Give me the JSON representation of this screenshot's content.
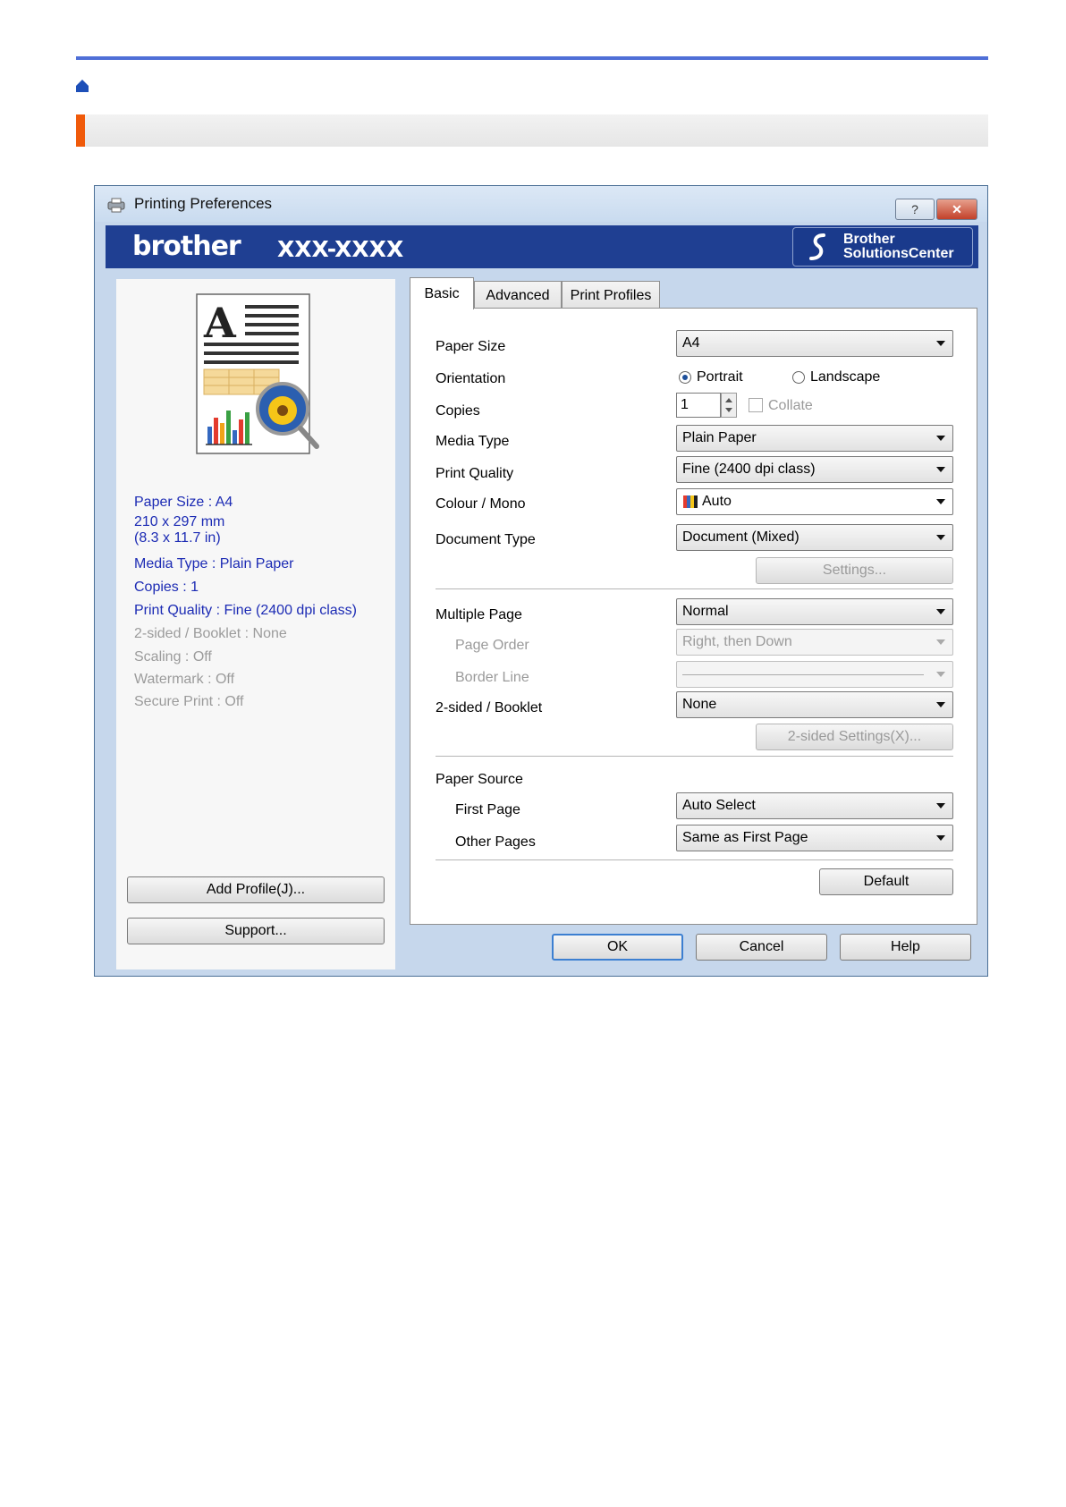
{
  "colors": {
    "header_line": "#4f6fd7",
    "section_accent": "#f05a0a",
    "brand_bar": "#1f3f92",
    "summary_text": "#1c2bb4"
  },
  "page": {
    "home_icon": "home-icon"
  },
  "dialog": {
    "title": "Printing Preferences",
    "help_button": "?",
    "close_button": "✕",
    "brand": {
      "logo": "brother",
      "model": "XXX-XXXX",
      "solutions_line1": "Brother",
      "solutions_line2": "SolutionsCenter"
    },
    "summary": {
      "paper_size": "Paper Size : A4",
      "dimensions_mm": "210 x 297 mm",
      "dimensions_in": "(8.3 x 11.7 in)",
      "media_type": "Media Type : Plain Paper",
      "copies": "Copies : 1",
      "print_quality": "Print Quality : Fine (2400 dpi class)",
      "two_sided": "2-sided / Booklet : None",
      "scaling": "Scaling : Off",
      "watermark": "Watermark : Off",
      "secure_print": "Secure Print : Off"
    },
    "left_buttons": {
      "add_profile": "Add Profile(J)...",
      "support": "Support..."
    },
    "tabs": [
      {
        "label": "Basic"
      },
      {
        "label": "Advanced"
      },
      {
        "label": "Print Profiles"
      }
    ],
    "basic": {
      "paper_size": {
        "label": "Paper Size",
        "value": "A4"
      },
      "orientation": {
        "label": "Orientation",
        "portrait": "Portrait",
        "landscape": "Landscape",
        "selected": "Portrait"
      },
      "copies": {
        "label": "Copies",
        "value": "1",
        "collate": "Collate"
      },
      "media_type": {
        "label": "Media Type",
        "value": "Plain Paper"
      },
      "print_quality": {
        "label": "Print Quality",
        "value": "Fine (2400 dpi class)"
      },
      "colour_mono": {
        "label": "Colour / Mono",
        "value": "Auto"
      },
      "document_type": {
        "label": "Document Type",
        "value": "Document (Mixed)"
      },
      "settings_button": "Settings...",
      "multiple_page": {
        "label": "Multiple Page",
        "value": "Normal"
      },
      "page_order": {
        "label": "Page Order",
        "value": "Right, then Down"
      },
      "border_line": {
        "label": "Border Line"
      },
      "two_sided": {
        "label": "2-sided / Booklet",
        "value": "None"
      },
      "two_sided_settings_button": "2-sided Settings(X)...",
      "paper_source": {
        "label": "Paper Source"
      },
      "first_page": {
        "label": "First Page",
        "value": "Auto Select"
      },
      "other_pages": {
        "label": "Other Pages",
        "value": "Same as First Page"
      },
      "default_button": "Default"
    },
    "footer": {
      "ok": "OK",
      "cancel": "Cancel",
      "help": "Help"
    }
  }
}
